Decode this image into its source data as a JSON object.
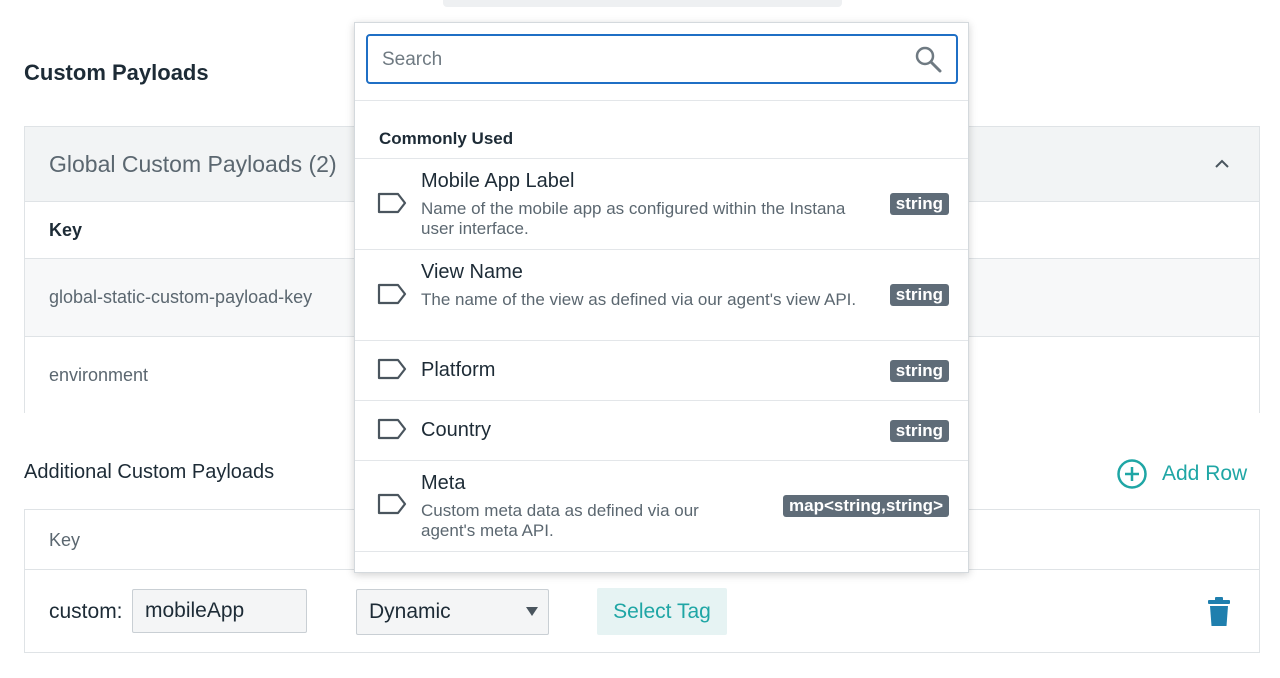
{
  "section_title": "Custom Payloads",
  "global_panel": {
    "title": "Global Custom Payloads (2)",
    "column_key": "Key",
    "rows": [
      "global-static-custom-payload-key",
      "environment"
    ]
  },
  "additional": {
    "title": "Additional Custom Payloads",
    "add_row_label": "Add Row",
    "column_key": "Key",
    "row": {
      "prefix": "custom:",
      "key_value": "mobileApp",
      "mode_value": "Dynamic",
      "select_tag_label": "Select Tag"
    }
  },
  "dropdown": {
    "search_placeholder": "Search",
    "group_label": "Commonly Used",
    "items": [
      {
        "name": "Mobile App Label",
        "desc": "Name of the mobile app as configured within the Instana user interface.",
        "type": "string"
      },
      {
        "name": "View Name",
        "desc": "The name of the view as defined via our agent's view API.",
        "type": "string"
      },
      {
        "name": "Platform",
        "desc": "",
        "type": "string"
      },
      {
        "name": "Country",
        "desc": "",
        "type": "string"
      },
      {
        "name": "Meta",
        "desc": "Custom meta data as defined via our agent's meta API.",
        "type": "map<string,string>"
      }
    ]
  },
  "colors": {
    "accent_teal": "#1fa6a5",
    "focus_blue": "#1f6fc5",
    "badge_gray": "#5f6c78",
    "text_dark": "#1d2b36"
  }
}
